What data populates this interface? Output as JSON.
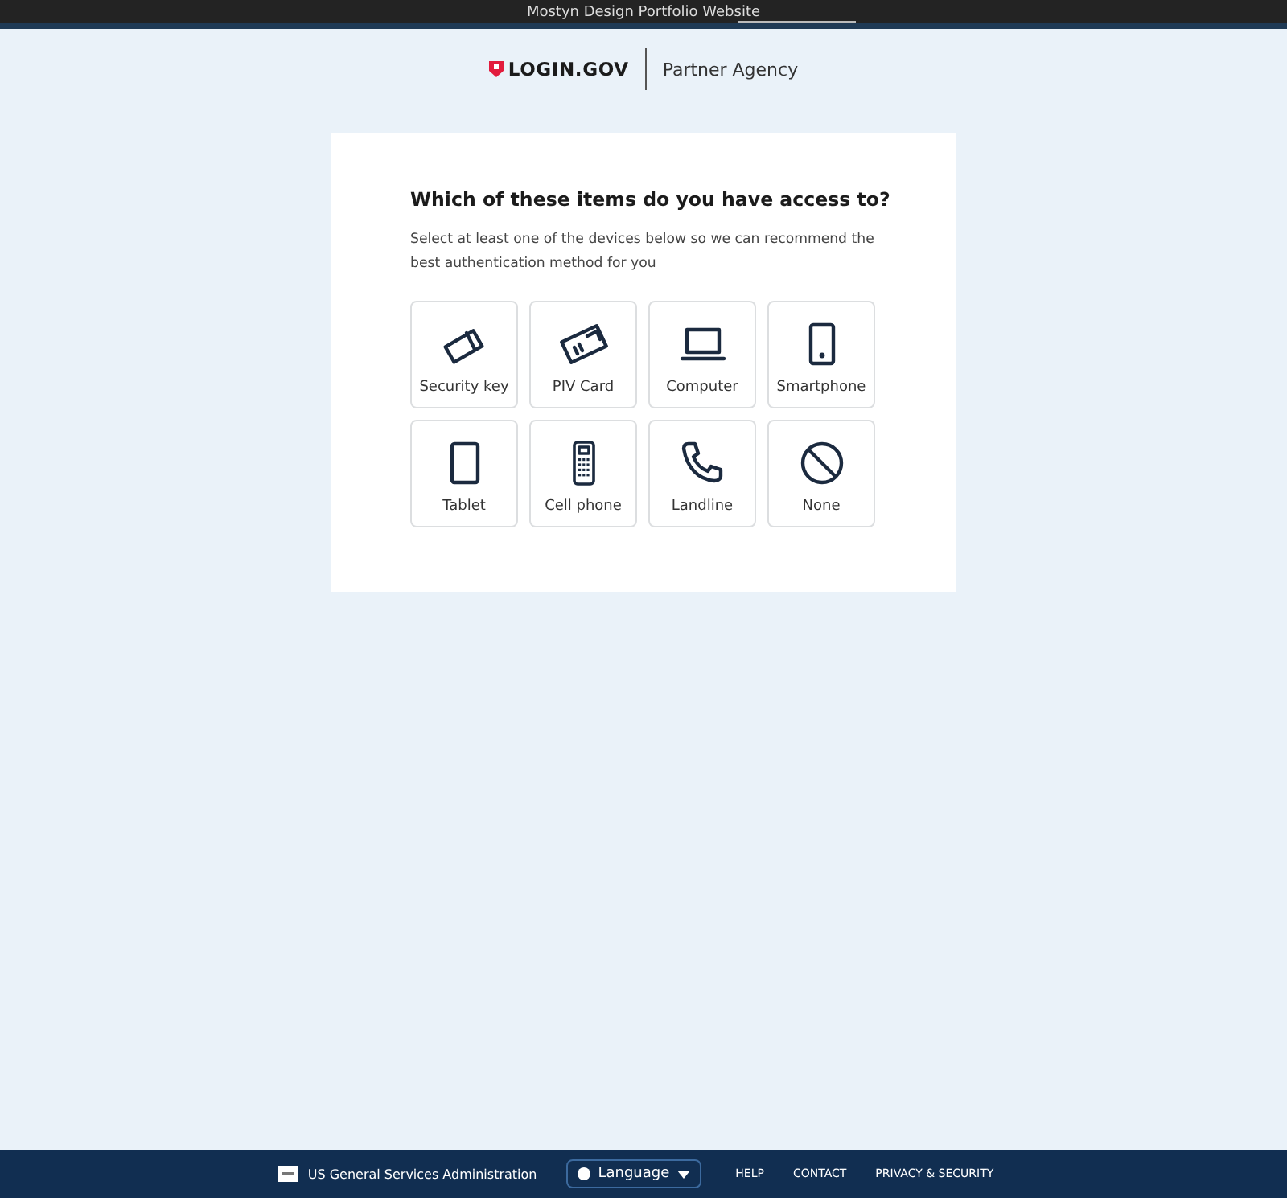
{
  "top_bar": {
    "title": "Mostyn Design Portfolio Website"
  },
  "header": {
    "logo": "LOGIN.GOV",
    "agency": "Partner Agency"
  },
  "card": {
    "heading": "Which of these items do you have access to?",
    "description": "Select at least one of the devices below so we can recommend the best authentication method for you",
    "options": [
      {
        "kind": "security-key",
        "label": "Security key",
        "selected": false
      },
      {
        "kind": "piv-card",
        "label": "PIV Card",
        "selected": false
      },
      {
        "kind": "computer",
        "label": "Computer",
        "selected": false
      },
      {
        "kind": "smartphone",
        "label": "Smartphone",
        "selected": false
      },
      {
        "kind": "tablet",
        "label": "Tablet",
        "selected": false
      },
      {
        "kind": "cell-phone",
        "label": "Cell phone",
        "selected": false
      },
      {
        "kind": "landline",
        "label": "Landline",
        "selected": false
      },
      {
        "kind": "none",
        "label": "None",
        "selected": false
      }
    ]
  },
  "footer": {
    "agency": "US General Services Administration",
    "language": "Language",
    "links": [
      "HELP",
      "CONTACT",
      "PRIVACY & SECURITY"
    ]
  }
}
